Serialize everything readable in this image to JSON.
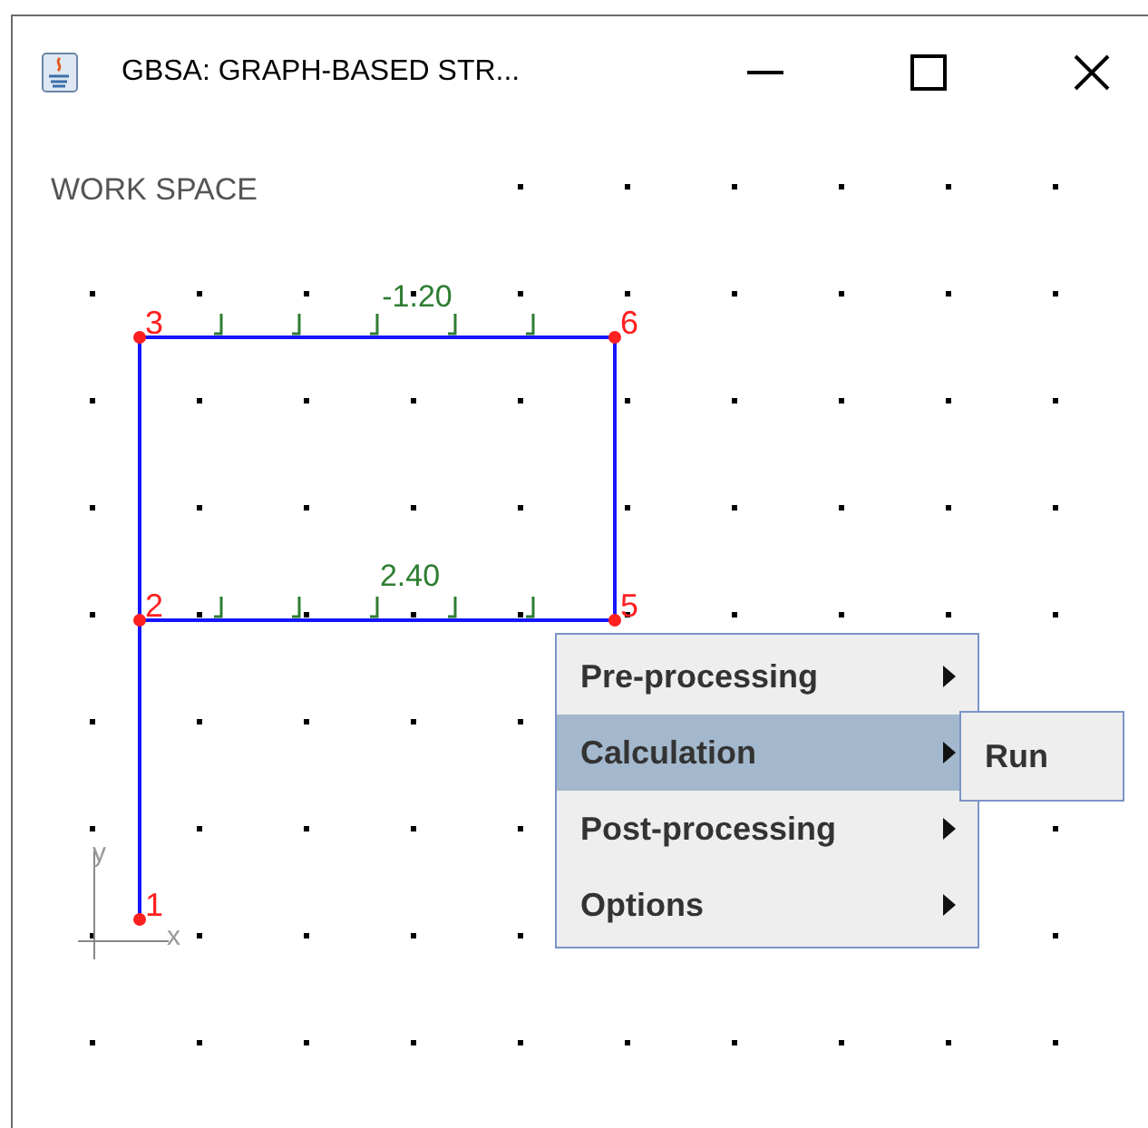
{
  "window": {
    "title": "GBSA: GRAPH-BASED STR..."
  },
  "workspace": {
    "label": "WORK SPACE",
    "nodes": [
      {
        "label": "3"
      },
      {
        "label": "6"
      },
      {
        "label": "2"
      },
      {
        "label": "5"
      },
      {
        "label": "1"
      }
    ],
    "loads": [
      {
        "value": "-1.20"
      },
      {
        "value": "2.40"
      }
    ],
    "axes": {
      "x": "x",
      "y": "y"
    }
  },
  "context_menu": {
    "items": [
      {
        "label": "Pre-processing",
        "selected": false
      },
      {
        "label": "Calculation",
        "selected": true,
        "submenu": [
          {
            "label": "Run"
          }
        ]
      },
      {
        "label": "Post-processing",
        "selected": false
      },
      {
        "label": "Options",
        "selected": false
      }
    ]
  }
}
